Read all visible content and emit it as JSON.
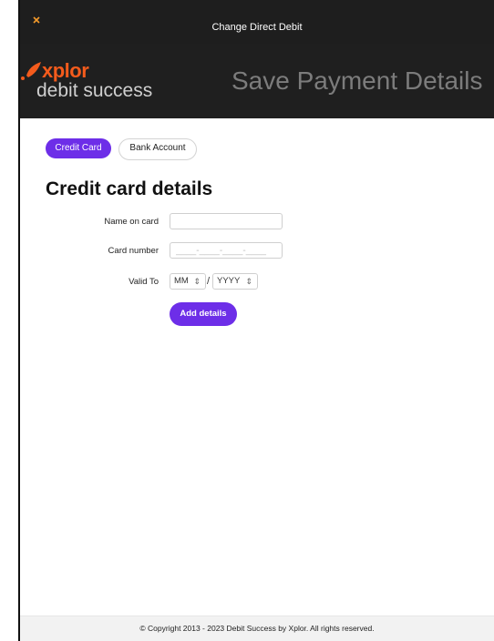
{
  "header": {
    "title": "Change Direct Debit",
    "close_icon": "close-icon"
  },
  "brand": {
    "logo_line1": "xplor",
    "logo_line2": "debit success",
    "page_title": "Save Payment Details",
    "colors": {
      "accent_orange": "#f45b1c",
      "primary_purple": "#6d2ee8",
      "dark_header": "#1e1e1e"
    }
  },
  "tabs": [
    {
      "label": "Credit Card",
      "active": true
    },
    {
      "label": "Bank Account",
      "active": false
    }
  ],
  "form": {
    "heading": "Credit card details",
    "name_label": "Name on card",
    "name_value": "",
    "card_label": "Card number",
    "card_placeholder": "____-____-____-____",
    "valid_label": "Valid To",
    "month_value": "MM",
    "year_value": "YYYY",
    "separator": "/",
    "submit_label": "Add details"
  },
  "footer": {
    "text": "© Copyright 2013 - 2023 Debit Success by Xplor. All rights reserved."
  }
}
